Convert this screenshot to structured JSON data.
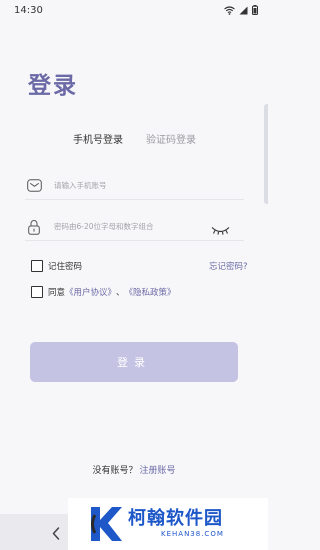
{
  "status_bar": {
    "time": "14:30"
  },
  "title": "登录",
  "tabs": [
    {
      "label": "手机号登录",
      "active": true
    },
    {
      "label": "验证码登录",
      "active": false
    }
  ],
  "phone_field": {
    "placeholder": "请输入手机账号",
    "value": "",
    "icon": "envelope-icon"
  },
  "password_field": {
    "placeholder": "密码由6-20位字母和数字组合",
    "value": "",
    "icon": "lock-icon",
    "toggle_icon": "eye-closed-icon"
  },
  "remember": {
    "label": "记住密码",
    "checked": false
  },
  "forgot": {
    "label": "忘记密码?"
  },
  "agreement": {
    "prefix": "同意",
    "user_agreement": "《用户协议》",
    "separator": "、",
    "privacy_policy": "《隐私政策》",
    "checked": false
  },
  "login_button": {
    "label": "登录"
  },
  "register": {
    "prompt": "没有账号？",
    "link": "注册账号"
  },
  "watermark": {
    "name": "柯翰软件园",
    "domain": "KEHAN38.COM"
  },
  "colors": {
    "accent": "#6b6aa7",
    "button": "#c4c3e4",
    "background": "#f7f7f9",
    "watermark": "#1d57c8"
  }
}
